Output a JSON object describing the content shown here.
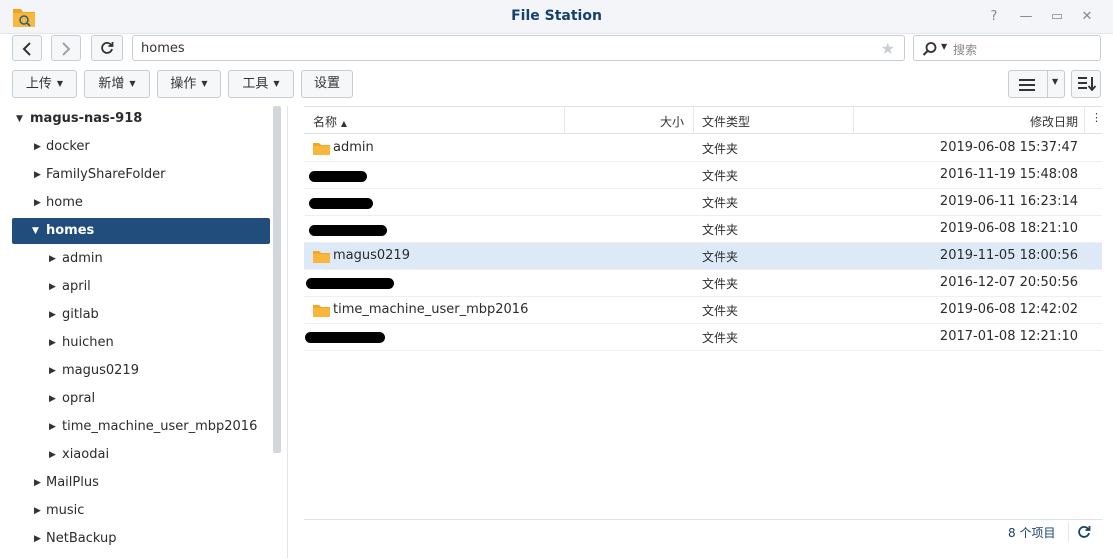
{
  "window": {
    "title": "File Station",
    "help": "?",
    "minimize": "—",
    "maximize": "▭",
    "close": "✕"
  },
  "toolbar": {
    "path": "homes",
    "search_placeholder": "搜索",
    "upload": "上传",
    "create": "新增",
    "action": "操作",
    "tools": "工具",
    "settings": "设置"
  },
  "tree": [
    {
      "label": "magus-nas-918",
      "expanded": true,
      "level": 0
    },
    {
      "label": "docker",
      "expanded": false,
      "level": 1
    },
    {
      "label": "FamilyShareFolder",
      "expanded": false,
      "level": 1
    },
    {
      "label": "home",
      "expanded": false,
      "level": 1
    },
    {
      "label": "homes",
      "expanded": true,
      "level": 1,
      "selected": true
    },
    {
      "label": "admin",
      "expanded": false,
      "level": 2
    },
    {
      "label": "april",
      "expanded": false,
      "level": 2
    },
    {
      "label": "gitlab",
      "expanded": false,
      "level": 2
    },
    {
      "label": "huichen",
      "expanded": false,
      "level": 2
    },
    {
      "label": "magus0219",
      "expanded": false,
      "level": 2
    },
    {
      "label": "opral",
      "expanded": false,
      "level": 2
    },
    {
      "label": "time_machine_user_mbp2016",
      "expanded": false,
      "level": 2
    },
    {
      "label": "xiaodai",
      "expanded": false,
      "level": 2
    },
    {
      "label": "MailPlus",
      "expanded": false,
      "level": 1
    },
    {
      "label": "music",
      "expanded": false,
      "level": 1
    },
    {
      "label": "NetBackup",
      "expanded": false,
      "level": 1
    }
  ],
  "columns": {
    "name": "名称",
    "size": "大小",
    "type": "文件类型",
    "modified": "修改日期"
  },
  "files": [
    {
      "name": "admin",
      "type": "文件夹",
      "modified": "2019-06-08 15:37:47",
      "redacted": false
    },
    {
      "name": "",
      "type": "文件夹",
      "modified": "2016-11-19 15:48:08",
      "redacted": true
    },
    {
      "name": "",
      "type": "文件夹",
      "modified": "2019-06-11 16:23:14",
      "redacted": true
    },
    {
      "name": "",
      "type": "文件夹",
      "modified": "2019-06-08 18:21:10",
      "redacted": true
    },
    {
      "name": "magus0219",
      "type": "文件夹",
      "modified": "2019-11-05 18:00:56",
      "redacted": false,
      "selected": true
    },
    {
      "name": "",
      "type": "文件夹",
      "modified": "2016-12-07 20:50:56",
      "redacted": true
    },
    {
      "name": "time_machine_user_mbp2016",
      "type": "文件夹",
      "modified": "2019-06-08 12:42:02",
      "redacted": false
    },
    {
      "name": "",
      "type": "文件夹",
      "modified": "2017-01-08 12:21:10",
      "redacted": true
    }
  ],
  "footer": {
    "count": "8 个项目"
  },
  "colors": {
    "accent": "#214d7c",
    "title": "#16406d",
    "folder": "#f5a623",
    "row_selected": "#dde9f7"
  }
}
